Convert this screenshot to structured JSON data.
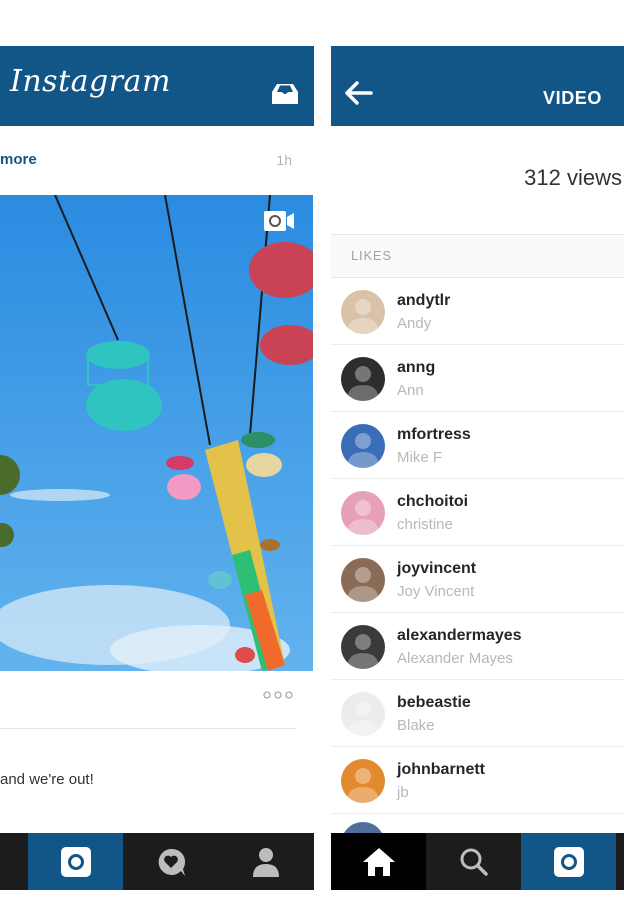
{
  "feed": {
    "app_title": "Instagram",
    "meta_link": "more",
    "timestamp": "1h",
    "caption": "and we're out!"
  },
  "video": {
    "title": "VIDEO",
    "views": "312 views",
    "likes_label": "LIKES",
    "likers": [
      {
        "username": "andytlr",
        "name": "Andy",
        "avatar_color": "#d9c2a7"
      },
      {
        "username": "anng",
        "name": "Ann",
        "avatar_color": "#2d2d2d"
      },
      {
        "username": "mfortress",
        "name": "Mike F",
        "avatar_color": "#3b6cb8"
      },
      {
        "username": "chchoitoi",
        "name": "christine",
        "avatar_color": "#e6a0b8"
      },
      {
        "username": "joyvincent",
        "name": "Joy Vincent",
        "avatar_color": "#8a6b55"
      },
      {
        "username": "alexandermayes",
        "name": "Alexander Mayes",
        "avatar_color": "#3a3a3a"
      },
      {
        "username": "bebeastie",
        "name": "Blake",
        "avatar_color": "#ececec"
      },
      {
        "username": "johnbarnett",
        "name": "jb",
        "avatar_color": "#e28a2e"
      }
    ]
  },
  "colors": {
    "header_blue": "#125688",
    "tab_bar": "#1c1c1c",
    "link_blue": "#125688"
  },
  "icons": {
    "left_header": "inbox-icon",
    "right_header": "back-arrow-icon",
    "photo_badge": "video-camera-icon",
    "left_tabs": [
      "camera-icon",
      "heart-bubble-icon",
      "profile-icon"
    ],
    "right_tabs": [
      "home-icon",
      "search-icon",
      "camera-icon"
    ]
  }
}
